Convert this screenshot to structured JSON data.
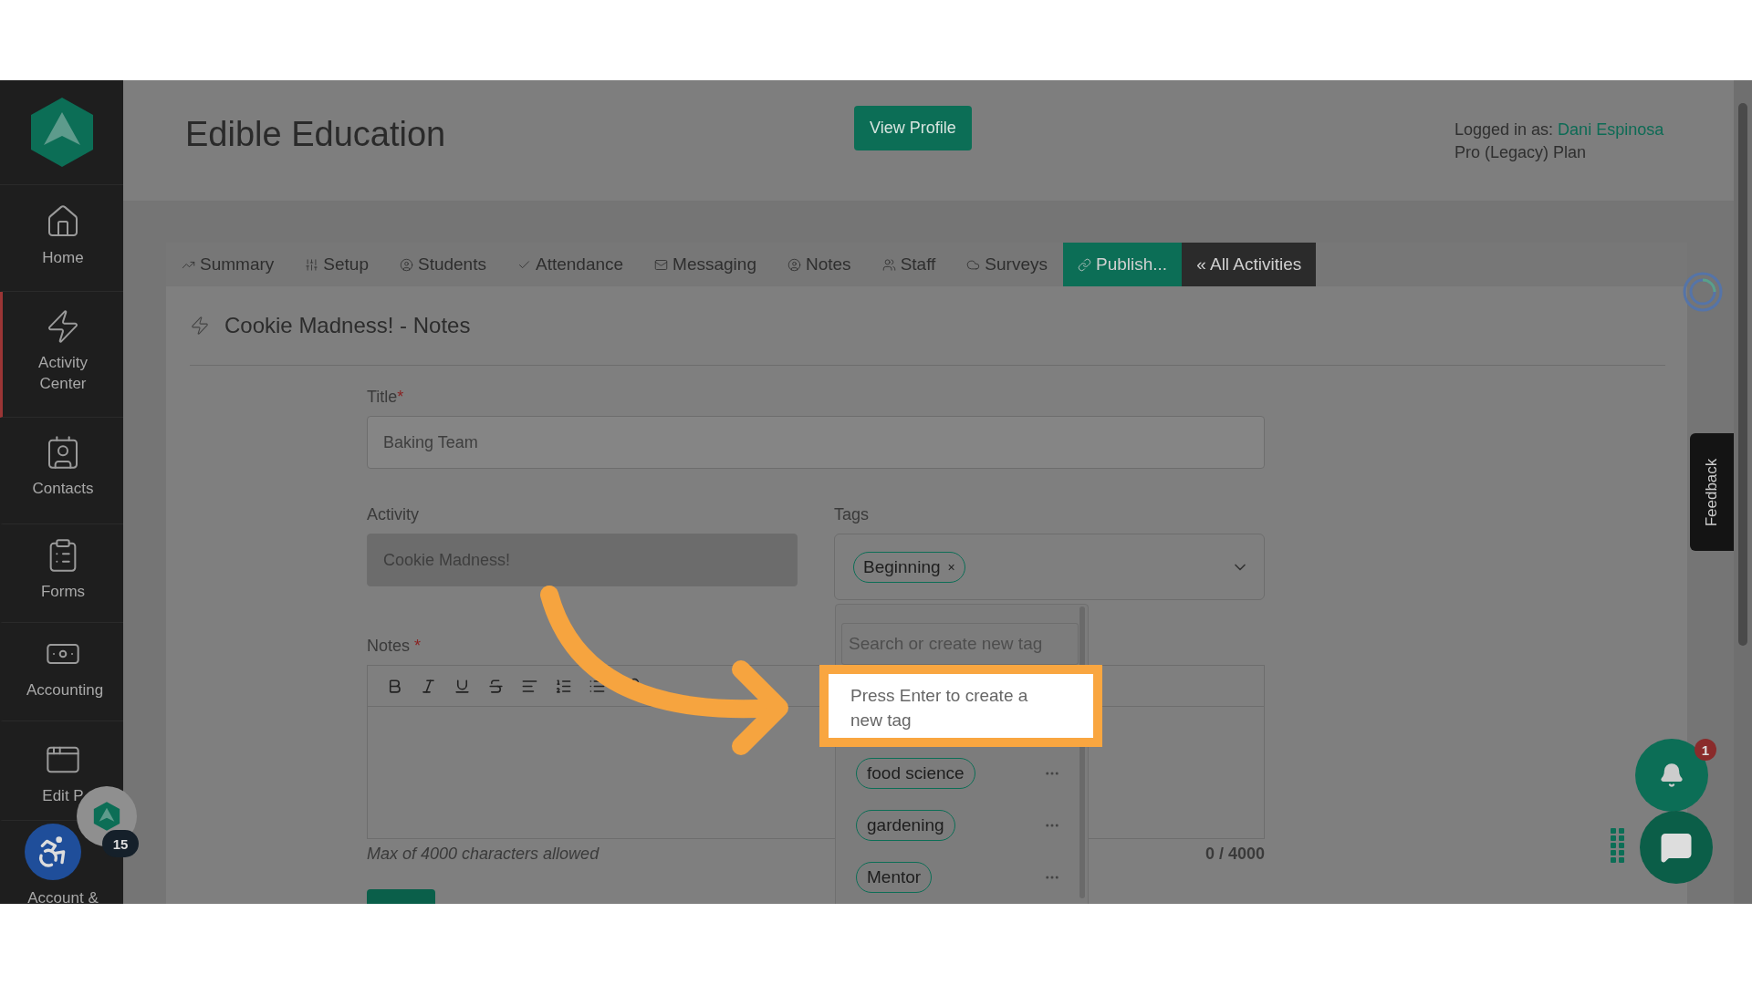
{
  "sidebar": {
    "items": [
      {
        "label": "Home",
        "selected": false
      },
      {
        "label": "Activity Center",
        "selected": true
      },
      {
        "label": "Contacts",
        "selected": false
      },
      {
        "label": "Forms",
        "selected": false
      },
      {
        "label": "Accounting",
        "selected": false
      },
      {
        "label": "Edit P",
        "selected": false
      },
      {
        "label": "Account &",
        "selected": false
      }
    ]
  },
  "header": {
    "title": "Edible Education",
    "button": "View Profile",
    "logged_in_label": "Logged in as:",
    "user": "Dani Espinosa",
    "plan": "Pro (Legacy) Plan"
  },
  "tabs": [
    {
      "label": "Summary",
      "kind": "plain"
    },
    {
      "label": "Setup",
      "kind": "plain"
    },
    {
      "label": "Students",
      "kind": "plain"
    },
    {
      "label": "Attendance",
      "kind": "plain"
    },
    {
      "label": "Messaging",
      "kind": "plain"
    },
    {
      "label": "Notes",
      "kind": "plain"
    },
    {
      "label": "Staff",
      "kind": "plain"
    },
    {
      "label": "Surveys",
      "kind": "plain"
    },
    {
      "label": "Publish...",
      "kind": "accent"
    },
    {
      "label": "« All Activities",
      "kind": "dark"
    }
  ],
  "page": {
    "heading": "Cookie Madness! - Notes"
  },
  "form": {
    "title": {
      "label": "Title",
      "required_mark": "*",
      "value": "Baking Team"
    },
    "activity": {
      "label": "Activity",
      "value": "Cookie Madness!",
      "disabled": true
    },
    "tags": {
      "label": "Tags",
      "chips": [
        {
          "label": "Beginning",
          "remove": "×"
        }
      ],
      "dropdown": {
        "placeholder": "Search or create new tag",
        "hint": "Press Enter to create a new tag",
        "options": [
          "food science",
          "gardening",
          "Mentor"
        ]
      }
    },
    "notes": {
      "label": "Notes",
      "required_mark": "*",
      "limit_text": "Max of 4000 characters allowed",
      "counter": "0 / 4000"
    }
  },
  "feedback": "Feedback",
  "notification_count": "1",
  "helper_badge": "15"
}
